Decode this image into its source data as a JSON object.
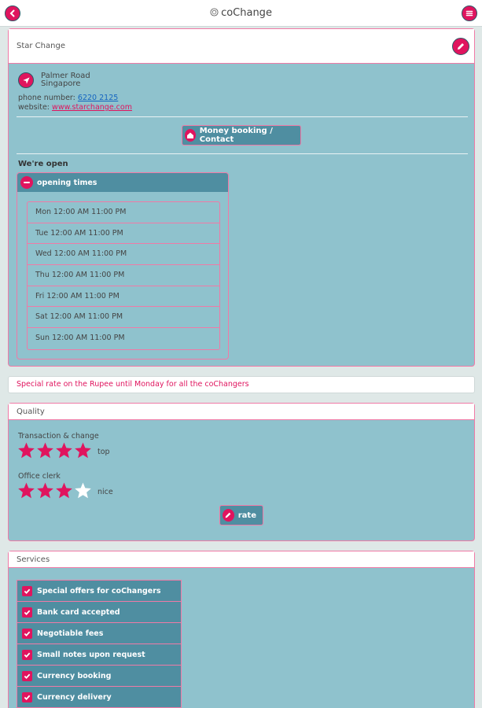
{
  "app": {
    "title": "coChange"
  },
  "shop": {
    "name": "Star Change",
    "address_line1": "Palmer Road",
    "address_line2": "Singapore",
    "phone_label": "phone number:",
    "phone": "6220 2125",
    "website_label": "website:",
    "website": "www.starchange.com",
    "booking_button": "Money booking / Contact",
    "open_status": "We're open",
    "opening_times_label": "opening times",
    "hours": [
      "Mon 12:00 AM 11:00 PM",
      "Tue 12:00 AM 11:00 PM",
      "Wed 12:00 AM 11:00 PM",
      "Thu 12:00 AM 11:00 PM",
      "Fri 12:00 AM 11:00 PM",
      "Sat 12:00 AM 11:00 PM",
      "Sun 12:00 AM 11:00 PM"
    ]
  },
  "promo": "Special rate on the Rupee until Monday for all the coChangers",
  "quality": {
    "title": "Quality",
    "ratings": [
      {
        "label": "Transaction & change",
        "stars": 4,
        "max": 4,
        "word": "top"
      },
      {
        "label": "Office clerk",
        "stars": 3,
        "max": 4,
        "word": "nice"
      }
    ],
    "rate_button": "rate"
  },
  "services": {
    "title": "Services",
    "items": [
      "Special offers for coChangers",
      "Bank card accepted",
      "Negotiable fees",
      "Small notes upon request",
      "Currency booking",
      "Currency delivery"
    ]
  },
  "colors": {
    "accent": "#e0145e",
    "panel": "#8fc2cd",
    "dark": "#4f8ea1",
    "border": "#f07aa6"
  }
}
